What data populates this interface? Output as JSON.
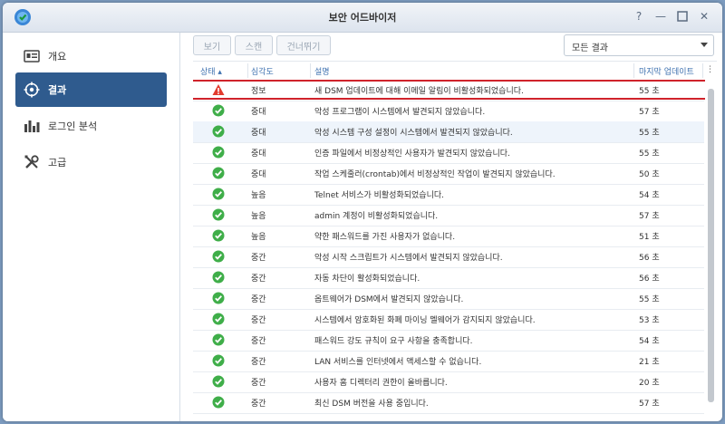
{
  "window": {
    "title": "보안 어드바이저"
  },
  "sidebar": {
    "items": [
      {
        "label": "개요",
        "icon": "overview-card-icon",
        "active": false
      },
      {
        "label": "결과",
        "icon": "target-icon",
        "active": true
      },
      {
        "label": "로그인 분석",
        "icon": "bar-chart-icon",
        "active": false
      },
      {
        "label": "고급",
        "icon": "tools-icon",
        "active": false
      }
    ]
  },
  "toolbar": {
    "view_label": "보기",
    "scan_label": "스캔",
    "skip_label": "건너뛰기",
    "filter_value": "모든 결과"
  },
  "table": {
    "columns": {
      "status": "상태 ▴",
      "severity": "심각도",
      "description": "설명",
      "last_update": "마지막 업데이트"
    },
    "rows": [
      {
        "status": "warning",
        "severity": "정보",
        "description": "새 DSM 업데이트에 대해 이메일 알림이 비활성화되었습니다.",
        "last_update": "55 초"
      },
      {
        "status": "ok",
        "severity": "중대",
        "description": "악성 프로그램이 시스템에서 발견되지 않았습니다.",
        "last_update": "57 초"
      },
      {
        "status": "ok",
        "severity": "중대",
        "description": "악성 시스템 구성 설정이 시스템에서 발견되지 않았습니다.",
        "last_update": "55 초"
      },
      {
        "status": "ok",
        "severity": "중대",
        "description": "인증 파일에서 비정상적인 사용자가 발견되지 않았습니다.",
        "last_update": "55 초"
      },
      {
        "status": "ok",
        "severity": "중대",
        "description": "작업 스케줄러(crontab)에서 비정상적인 작업이 발견되지 않았습니다.",
        "last_update": "50 초"
      },
      {
        "status": "ok",
        "severity": "높음",
        "description": "Telnet 서비스가 비활성화되었습니다.",
        "last_update": "54 초"
      },
      {
        "status": "ok",
        "severity": "높음",
        "description": "admin 계정이 비활성화되었습니다.",
        "last_update": "57 초"
      },
      {
        "status": "ok",
        "severity": "높음",
        "description": "약한 패스워드를 가진 사용자가 없습니다.",
        "last_update": "51 초"
      },
      {
        "status": "ok",
        "severity": "중간",
        "description": "악성 시작 스크립트가 시스템에서 발견되지 않았습니다.",
        "last_update": "56 초"
      },
      {
        "status": "ok",
        "severity": "중간",
        "description": "자동 차단이 활성화되었습니다.",
        "last_update": "56 초"
      },
      {
        "status": "ok",
        "severity": "중간",
        "description": "옵트웨어가 DSM에서 발견되지 않았습니다.",
        "last_update": "55 초"
      },
      {
        "status": "ok",
        "severity": "중간",
        "description": "시스템에서 암호화된 화폐 마이닝 멜웨어가 감지되지 않았습니다.",
        "last_update": "53 초"
      },
      {
        "status": "ok",
        "severity": "중간",
        "description": "패스워드 강도 규칙이 요구 사항을 충족합니다.",
        "last_update": "54 초"
      },
      {
        "status": "ok",
        "severity": "중간",
        "description": "LAN 서비스를 인터넷에서 액세스할 수 없습니다.",
        "last_update": "21 초"
      },
      {
        "status": "ok",
        "severity": "중간",
        "description": "사용자 홈 디렉터리 권한이 올바릅니다.",
        "last_update": "20 초"
      },
      {
        "status": "ok",
        "severity": "중간",
        "description": "최신 DSM 버전을 사용 중입니다.",
        "last_update": "57 초"
      }
    ]
  },
  "colors": {
    "accent": "#2f5b8e",
    "ok": "#3fae49",
    "warning": "#e23b2e",
    "selection": "#d0232b"
  }
}
